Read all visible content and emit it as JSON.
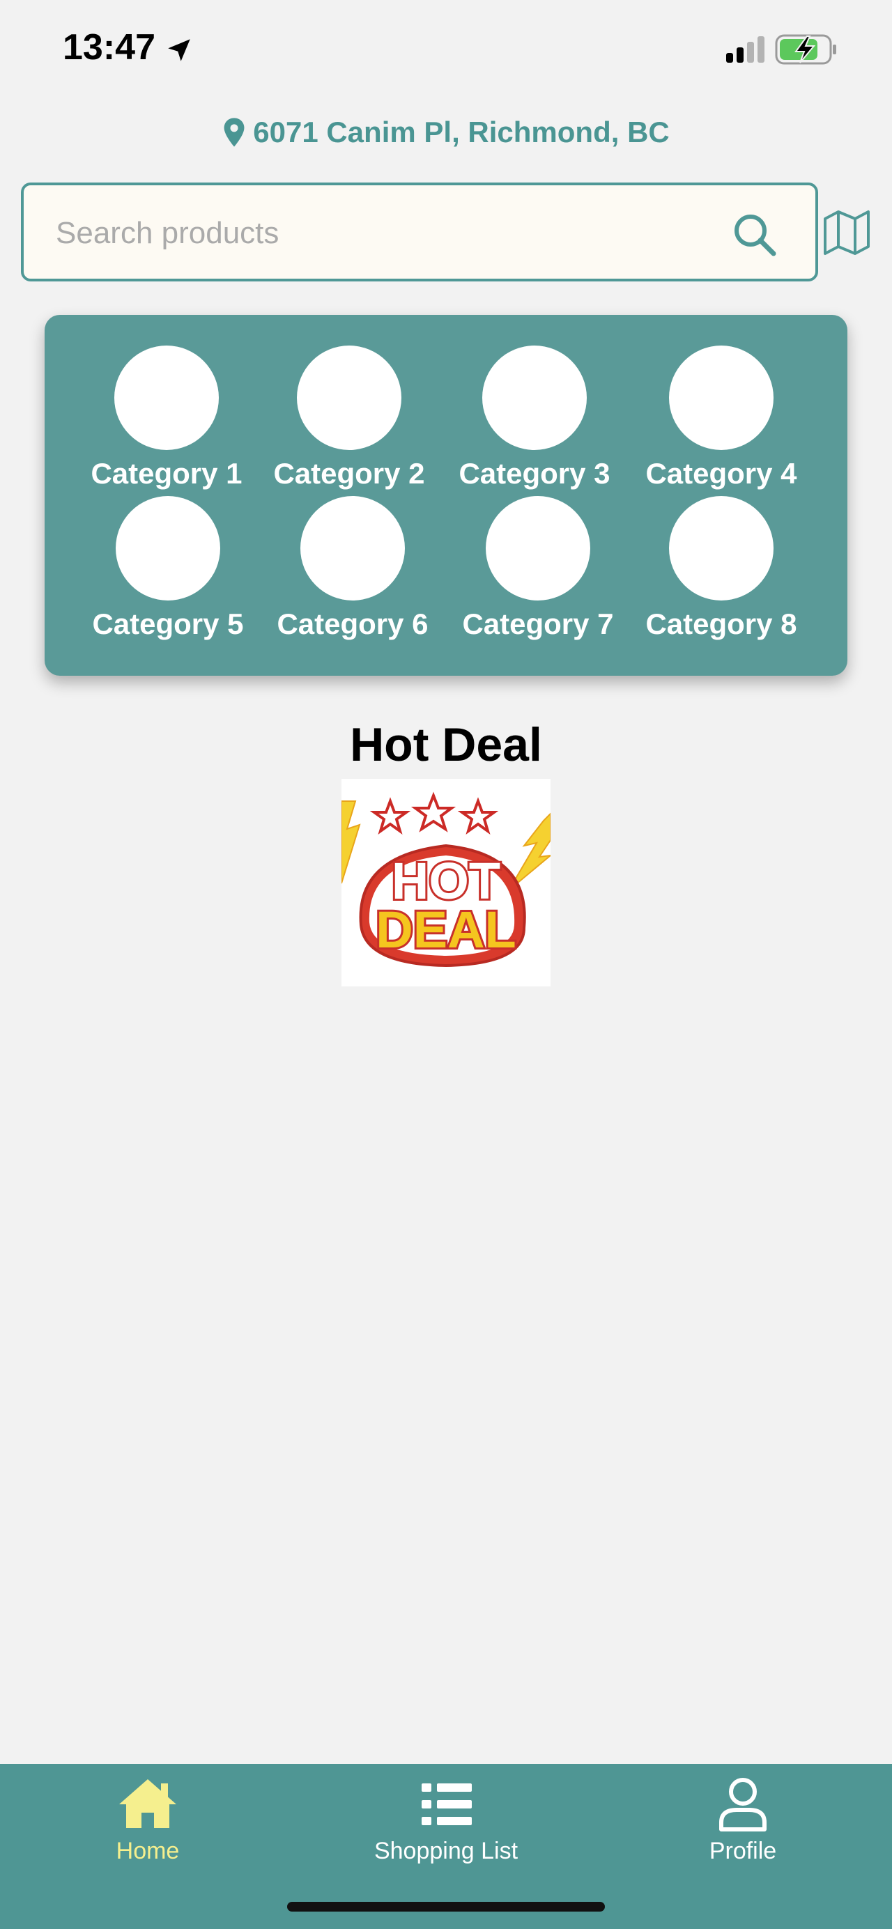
{
  "status_bar": {
    "time": "13:47"
  },
  "address": {
    "text": "6071 Canim Pl, Richmond, BC",
    "color": "#4a9593"
  },
  "search": {
    "placeholder": "Search products",
    "value": ""
  },
  "categories": [
    {
      "label": "Category 1"
    },
    {
      "label": "Category 2"
    },
    {
      "label": "Category 3"
    },
    {
      "label": "Category 4"
    },
    {
      "label": "Category 5"
    },
    {
      "label": "Category 6"
    },
    {
      "label": "Category 7"
    },
    {
      "label": "Category 8"
    }
  ],
  "hot_deal": {
    "title": "Hot Deal",
    "image_word_1": "HOT",
    "image_word_2": "DEAL"
  },
  "bottom_nav": {
    "items": [
      {
        "label": "Home",
        "icon": "home-icon",
        "active": true
      },
      {
        "label": "Shopping List",
        "icon": "list-icon",
        "active": false
      },
      {
        "label": "Profile",
        "icon": "user-icon",
        "active": false
      }
    ]
  },
  "colors": {
    "accent": "#5a9a98",
    "nav_bg": "#4f9694",
    "nav_active": "#f5ef8e",
    "page_bg": "#f2f2f2",
    "search_bg": "#fdfaf3"
  }
}
